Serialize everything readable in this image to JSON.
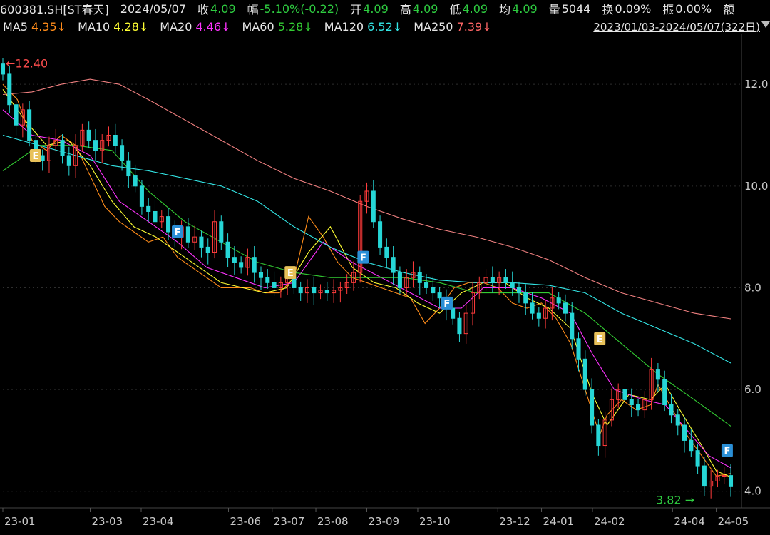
{
  "header": {
    "symbol": "600381.SH[ST春天]",
    "date": "2024/05/07",
    "close_label": "收",
    "close_value": "4.09",
    "change_label": "幅",
    "change_value": "-5.10%(-0.22)",
    "open_label": "开",
    "open_value": "4.09",
    "high_label": "高",
    "high_value": "4.09",
    "low_label": "低",
    "low_value": "4.09",
    "avg_label": "均",
    "avg_value": "4.09",
    "volume_label": "量",
    "volume_value": "5044",
    "turnover_label": "换",
    "turnover_value": "0.09%",
    "amplitude_label": "振",
    "amplitude_value": "0.00%",
    "amount_label": "额"
  },
  "ma_bar": {
    "items": [
      {
        "label": "MA5",
        "value": "4.35↓",
        "color": "#ff8c1a"
      },
      {
        "label": "MA10",
        "value": "4.28↓",
        "color": "#ffff33"
      },
      {
        "label": "MA20",
        "value": "4.46↓",
        "color": "#ff33ff"
      },
      {
        "label": "MA60",
        "value": "5.28↓",
        "color": "#33cc33"
      },
      {
        "label": "MA120",
        "value": "6.52↓",
        "color": "#33e6e6"
      },
      {
        "label": "MA250",
        "value": "7.39↓",
        "color": "#ff6666"
      }
    ],
    "range": "2023/01/03-2024/05/07(322日)"
  },
  "chart_data": {
    "type": "candlestick",
    "y_ticks": [
      "12.0",
      "10.0",
      "8.0",
      "6.0",
      "4.0"
    ],
    "y_tick_values": [
      12.0,
      10.0,
      8.0,
      6.0,
      4.0
    ],
    "ylim": [
      3.8,
      12.9
    ],
    "x_ticks": [
      "23-01",
      "23-03",
      "23-04",
      "23-06",
      "23-07",
      "23-08",
      "23-09",
      "23-10",
      "23-12",
      "24-01",
      "24-02",
      "24-04",
      "24-05"
    ],
    "max_label": "12.40",
    "min_label": "3.82",
    "colors": {
      "up": "#ff3b3b",
      "down": "#26d6d6",
      "grid": "#2e2e2e"
    },
    "events": [
      {
        "label": "E",
        "date": "23-01",
        "price": 10.6,
        "color": "#e8c15a"
      },
      {
        "label": "F",
        "date": "23-04",
        "price": 9.1,
        "color": "#2a8fd6"
      },
      {
        "label": "E",
        "date": "23-07",
        "price": 8.3,
        "color": "#e8c15a"
      },
      {
        "label": "F",
        "date": "23-08",
        "price": 8.6,
        "color": "#2a8fd6"
      },
      {
        "label": "F",
        "date": "23-10",
        "price": 7.7,
        "color": "#2a8fd6"
      },
      {
        "label": "E",
        "date": "24-01",
        "price": 7.0,
        "color": "#e8c15a"
      },
      {
        "label": "F",
        "date": "24-05",
        "price": 4.8,
        "color": "#2a8fd6"
      }
    ],
    "series": [
      {
        "name": "MA5",
        "color": "#ff8c1a",
        "points": [
          [
            0,
            12.0
          ],
          [
            0.02,
            11.7
          ],
          [
            0.04,
            10.9
          ],
          [
            0.06,
            10.7
          ],
          [
            0.08,
            11.0
          ],
          [
            0.1,
            10.8
          ],
          [
            0.12,
            10.2
          ],
          [
            0.14,
            9.6
          ],
          [
            0.16,
            9.3
          ],
          [
            0.18,
            9.1
          ],
          [
            0.2,
            8.9
          ],
          [
            0.22,
            9.0
          ],
          [
            0.24,
            8.6
          ],
          [
            0.26,
            8.4
          ],
          [
            0.28,
            8.2
          ],
          [
            0.3,
            8.0
          ],
          [
            0.32,
            8.0
          ],
          [
            0.34,
            8.0
          ],
          [
            0.36,
            7.9
          ],
          [
            0.38,
            7.9
          ],
          [
            0.4,
            8.2
          ],
          [
            0.42,
            9.4
          ],
          [
            0.44,
            9.0
          ],
          [
            0.46,
            8.5
          ],
          [
            0.48,
            8.2
          ],
          [
            0.5,
            8.1
          ],
          [
            0.52,
            8.0
          ],
          [
            0.54,
            7.9
          ],
          [
            0.56,
            7.8
          ],
          [
            0.58,
            7.3
          ],
          [
            0.6,
            7.6
          ],
          [
            0.62,
            8.0
          ],
          [
            0.64,
            8.1
          ],
          [
            0.66,
            8.1
          ],
          [
            0.68,
            8.0
          ],
          [
            0.7,
            7.7
          ],
          [
            0.72,
            7.6
          ],
          [
            0.74,
            7.7
          ],
          [
            0.76,
            7.4
          ],
          [
            0.78,
            6.9
          ],
          [
            0.8,
            6.0
          ],
          [
            0.82,
            5.1
          ],
          [
            0.83,
            5.5
          ],
          [
            0.85,
            5.8
          ],
          [
            0.87,
            5.6
          ],
          [
            0.89,
            5.7
          ],
          [
            0.9,
            6.1
          ],
          [
            0.92,
            5.6
          ],
          [
            0.94,
            5.1
          ],
          [
            0.96,
            4.7
          ],
          [
            0.98,
            4.3
          ],
          [
            1.0,
            4.35
          ]
        ]
      },
      {
        "name": "MA10",
        "color": "#ffff33",
        "points": [
          [
            0,
            11.9
          ],
          [
            0.03,
            11.3
          ],
          [
            0.06,
            10.8
          ],
          [
            0.09,
            10.9
          ],
          [
            0.12,
            10.4
          ],
          [
            0.15,
            9.7
          ],
          [
            0.18,
            9.2
          ],
          [
            0.21,
            9.0
          ],
          [
            0.24,
            8.7
          ],
          [
            0.27,
            8.4
          ],
          [
            0.3,
            8.1
          ],
          [
            0.33,
            8.0
          ],
          [
            0.36,
            7.9
          ],
          [
            0.39,
            8.0
          ],
          [
            0.42,
            8.7
          ],
          [
            0.45,
            9.2
          ],
          [
            0.48,
            8.4
          ],
          [
            0.51,
            8.1
          ],
          [
            0.54,
            8.0
          ],
          [
            0.57,
            7.7
          ],
          [
            0.6,
            7.5
          ],
          [
            0.63,
            7.9
          ],
          [
            0.66,
            8.1
          ],
          [
            0.69,
            8.1
          ],
          [
            0.72,
            7.8
          ],
          [
            0.75,
            7.6
          ],
          [
            0.78,
            7.2
          ],
          [
            0.81,
            5.9
          ],
          [
            0.83,
            5.3
          ],
          [
            0.86,
            5.9
          ],
          [
            0.89,
            5.8
          ],
          [
            0.91,
            6.1
          ],
          [
            0.93,
            5.6
          ],
          [
            0.96,
            4.9
          ],
          [
            0.98,
            4.4
          ],
          [
            1.0,
            4.28
          ]
        ]
      },
      {
        "name": "MA20",
        "color": "#ff33ff",
        "points": [
          [
            0,
            11.5
          ],
          [
            0.04,
            11.0
          ],
          [
            0.08,
            10.9
          ],
          [
            0.12,
            10.6
          ],
          [
            0.16,
            9.7
          ],
          [
            0.2,
            9.3
          ],
          [
            0.24,
            8.9
          ],
          [
            0.28,
            8.4
          ],
          [
            0.32,
            8.2
          ],
          [
            0.36,
            8.0
          ],
          [
            0.4,
            8.1
          ],
          [
            0.44,
            8.9
          ],
          [
            0.48,
            8.5
          ],
          [
            0.52,
            8.2
          ],
          [
            0.56,
            7.9
          ],
          [
            0.6,
            7.6
          ],
          [
            0.63,
            7.6
          ],
          [
            0.66,
            8.0
          ],
          [
            0.7,
            8.0
          ],
          [
            0.74,
            7.8
          ],
          [
            0.78,
            7.5
          ],
          [
            0.81,
            6.7
          ],
          [
            0.84,
            6.0
          ],
          [
            0.88,
            5.8
          ],
          [
            0.91,
            5.7
          ],
          [
            0.94,
            5.2
          ],
          [
            0.97,
            4.7
          ],
          [
            1.0,
            4.46
          ]
        ]
      },
      {
        "name": "MA60",
        "color": "#33cc33",
        "points": [
          [
            0,
            10.3
          ],
          [
            0.05,
            10.8
          ],
          [
            0.1,
            10.8
          ],
          [
            0.15,
            10.7
          ],
          [
            0.2,
            9.9
          ],
          [
            0.25,
            9.3
          ],
          [
            0.3,
            8.9
          ],
          [
            0.35,
            8.5
          ],
          [
            0.4,
            8.3
          ],
          [
            0.45,
            8.2
          ],
          [
            0.5,
            8.2
          ],
          [
            0.55,
            8.2
          ],
          [
            0.6,
            8.1
          ],
          [
            0.65,
            7.9
          ],
          [
            0.7,
            7.9
          ],
          [
            0.75,
            7.9
          ],
          [
            0.8,
            7.5
          ],
          [
            0.85,
            6.9
          ],
          [
            0.9,
            6.3
          ],
          [
            0.95,
            5.8
          ],
          [
            1.0,
            5.28
          ]
        ]
      },
      {
        "name": "MA120",
        "color": "#33e6e6",
        "points": [
          [
            0,
            11.0
          ],
          [
            0.05,
            10.8
          ],
          [
            0.1,
            10.6
          ],
          [
            0.15,
            10.4
          ],
          [
            0.2,
            10.3
          ],
          [
            0.25,
            10.15
          ],
          [
            0.3,
            10.0
          ],
          [
            0.35,
            9.7
          ],
          [
            0.4,
            9.2
          ],
          [
            0.45,
            8.8
          ],
          [
            0.5,
            8.5
          ],
          [
            0.55,
            8.3
          ],
          [
            0.6,
            8.15
          ],
          [
            0.65,
            8.1
          ],
          [
            0.7,
            8.1
          ],
          [
            0.75,
            8.05
          ],
          [
            0.8,
            7.9
          ],
          [
            0.85,
            7.5
          ],
          [
            0.9,
            7.2
          ],
          [
            0.95,
            6.9
          ],
          [
            1.0,
            6.52
          ]
        ]
      },
      {
        "name": "MA250",
        "color": "#f08080",
        "points": [
          [
            0,
            11.8
          ],
          [
            0.04,
            11.85
          ],
          [
            0.08,
            12.0
          ],
          [
            0.12,
            12.1
          ],
          [
            0.16,
            12.0
          ],
          [
            0.2,
            11.7
          ],
          [
            0.25,
            11.3
          ],
          [
            0.3,
            10.9
          ],
          [
            0.35,
            10.5
          ],
          [
            0.4,
            10.15
          ],
          [
            0.45,
            9.9
          ],
          [
            0.5,
            9.6
          ],
          [
            0.55,
            9.35
          ],
          [
            0.6,
            9.15
          ],
          [
            0.65,
            9.0
          ],
          [
            0.7,
            8.8
          ],
          [
            0.75,
            8.55
          ],
          [
            0.8,
            8.2
          ],
          [
            0.85,
            7.9
          ],
          [
            0.9,
            7.7
          ],
          [
            0.95,
            7.5
          ],
          [
            1.0,
            7.39
          ]
        ]
      }
    ],
    "candles_close": [
      12.2,
      11.6,
      11.2,
      11.5,
      10.9,
      10.6,
      10.5,
      10.8,
      10.9,
      10.6,
      10.4,
      10.8,
      11.1,
      10.9,
      10.7,
      10.9,
      11.0,
      10.8,
      10.5,
      10.2,
      10.0,
      9.6,
      9.5,
      9.3,
      9.4,
      9.1,
      9.0,
      9.2,
      8.9,
      9.0,
      8.8,
      8.7,
      9.3,
      8.9,
      8.6,
      8.5,
      8.4,
      8.6,
      8.3,
      8.2,
      8.1,
      8.0,
      8.1,
      8.2,
      8.0,
      7.9,
      8.0,
      7.9,
      7.95,
      7.9,
      7.95,
      8.0,
      8.1,
      8.3,
      9.7,
      9.9,
      9.3,
      8.8,
      8.6,
      8.3,
      8.0,
      8.2,
      8.3,
      8.1,
      8.0,
      7.9,
      7.8,
      7.6,
      7.4,
      7.1,
      7.5,
      7.9,
      8.1,
      8.2,
      8.1,
      8.2,
      8.1,
      8.0,
      7.9,
      7.7,
      7.5,
      7.4,
      7.6,
      7.8,
      7.7,
      7.5,
      7.0,
      6.6,
      6.0,
      5.3,
      4.9,
      5.4,
      5.8,
      6.0,
      5.8,
      5.7,
      5.6,
      5.8,
      6.4,
      6.2,
      5.7,
      5.5,
      5.3,
      5.0,
      4.8,
      4.5,
      4.1,
      4.2,
      4.3,
      4.31,
      4.09
    ]
  }
}
